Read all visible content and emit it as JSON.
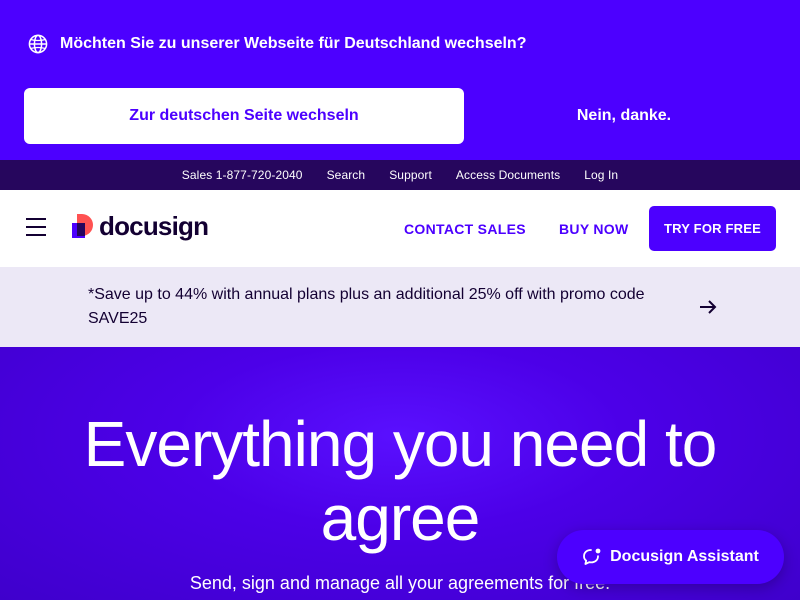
{
  "locale_banner": {
    "question": "Möchten Sie zu unserer Webseite für Deutschland wechseln?",
    "switch_label": "Zur deutschen Seite wechseln",
    "decline_label": "Nein, danke.",
    "icon": "globe-icon"
  },
  "utility_nav": {
    "items": [
      {
        "label": "Sales 1-877-720-2040"
      },
      {
        "label": "Search"
      },
      {
        "label": "Support"
      },
      {
        "label": "Access Documents"
      },
      {
        "label": "Log In"
      }
    ]
  },
  "header": {
    "logo_text": "docusign",
    "contact_label": "CONTACT SALES",
    "buy_label": "BUY NOW",
    "try_label": "TRY FOR FREE",
    "menu_icon": "hamburger-menu-icon"
  },
  "promo": {
    "text": "*Save up to 44% with annual plans plus an additional 25% off with promo code SAVE25",
    "icon": "arrow-right-icon"
  },
  "hero": {
    "title": "Everything you need to agree",
    "subtitle": "Send, sign and manage all your agreements for free."
  },
  "assistant": {
    "label": "Docusign Assistant",
    "icon": "chat-bubble-icon"
  },
  "colors": {
    "brand_purple": "#4c00ff",
    "utility_bar": "#26065d",
    "ink": "#130032",
    "promo_bg": "#ece8f6"
  }
}
